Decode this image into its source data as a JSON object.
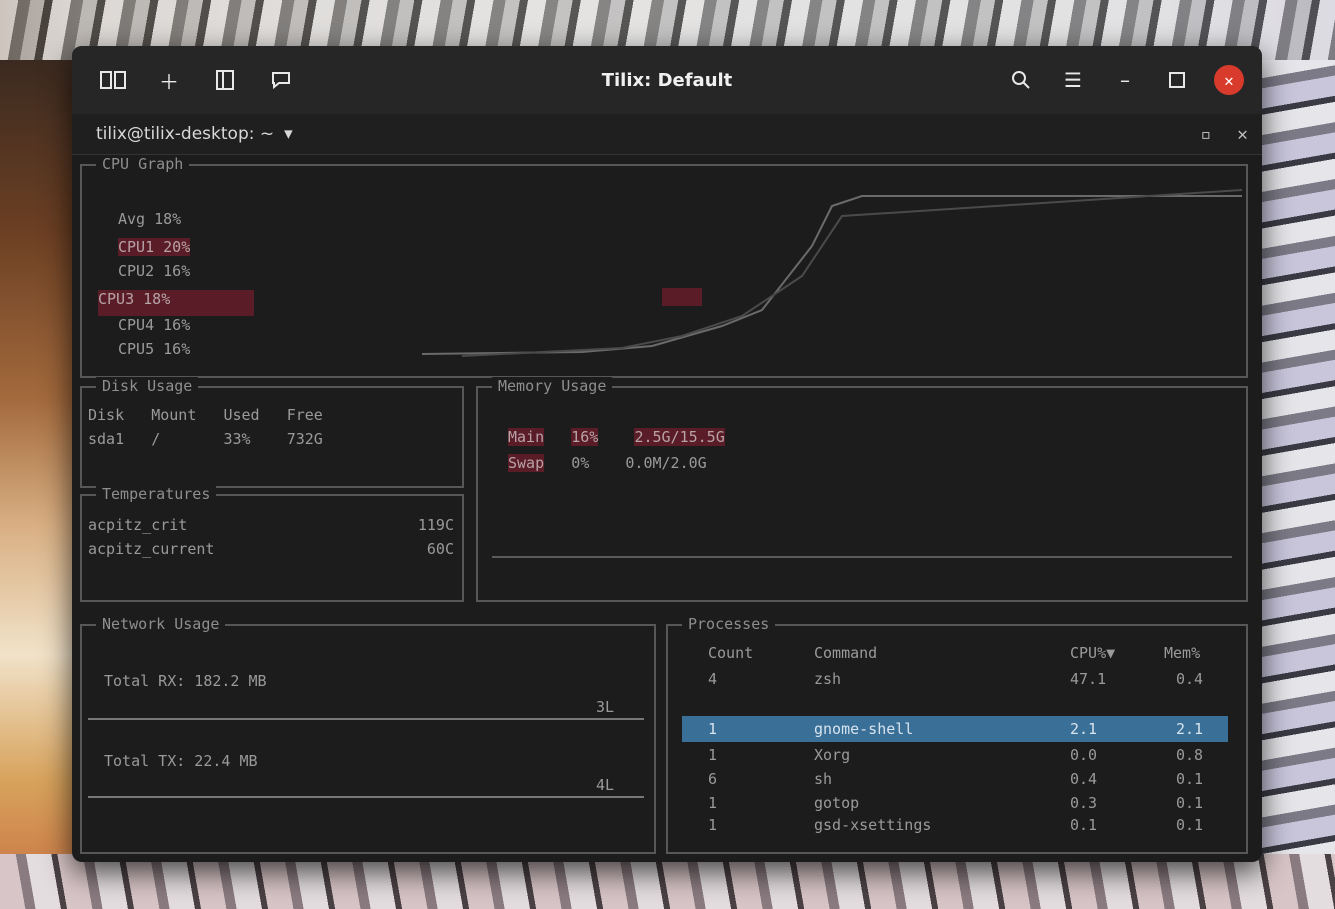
{
  "window": {
    "title": "Tilix: Default",
    "session_label": "tilix@tilix-desktop: ~",
    "session_caret": "▾"
  },
  "headerbar": {
    "left_icons": [
      "split-icon",
      "add-icon",
      "sidebar-icon",
      "chat-icon"
    ],
    "right_icons": [
      "search-icon",
      "menu-icon",
      "minimize-icon",
      "maximize-icon",
      "close-icon"
    ]
  },
  "cpu_graph": {
    "title": "CPU Graph",
    "legend": [
      {
        "label": "Avg",
        "value": "18%"
      },
      {
        "label": "CPU1",
        "value": "20%"
      },
      {
        "label": "CPU2",
        "value": "16%"
      },
      {
        "label": "CPU3",
        "value": "18%"
      },
      {
        "label": "CPU4",
        "value": "16%"
      },
      {
        "label": "CPU5",
        "value": "16%"
      }
    ]
  },
  "disk_usage": {
    "title": "Disk Usage",
    "headers": [
      "Disk",
      "Mount",
      "Used",
      "Free"
    ],
    "rows": [
      [
        "sda1",
        "/",
        "33%",
        "732G"
      ]
    ]
  },
  "memory_usage": {
    "title": "Memory Usage",
    "rows": [
      {
        "label": "Main",
        "percent": "16%",
        "detail": "2.5G/15.5G"
      },
      {
        "label": "Swap",
        "percent": "0%",
        "detail": "0.0M/2.0G"
      }
    ]
  },
  "temperatures": {
    "title": "Temperatures",
    "rows": [
      {
        "label": "acpitz_crit",
        "value": "119C"
      },
      {
        "label": "acpitz_current",
        "value": "60C"
      }
    ]
  },
  "network": {
    "title": "Network Usage",
    "rx_label": "Total RX: 182.2 MB",
    "tx_label": "Total TX: 22.4 MB",
    "rx_rate": "3L",
    "tx_rate": "4L"
  },
  "processes": {
    "title": "Processes",
    "headers": [
      "Count",
      "Command",
      "CPU%▼",
      "Mem%"
    ],
    "rows": [
      {
        "count": "4",
        "command": "zsh",
        "cpu": "47.1",
        "mem": "0.4"
      },
      {
        "count": "1",
        "command": "gnome-shell",
        "cpu": "2.1",
        "mem": "2.1"
      },
      {
        "count": "1",
        "command": "Xorg",
        "cpu": "0.0",
        "mem": "0.8"
      },
      {
        "count": "6",
        "command": "sh",
        "cpu": "0.4",
        "mem": "0.1"
      },
      {
        "count": "1",
        "command": "gotop",
        "cpu": "0.3",
        "mem": "0.1"
      },
      {
        "count": "1",
        "command": "gsd-xsettings",
        "cpu": "0.1",
        "mem": "0.1"
      }
    ]
  },
  "colors": {
    "accent_highlight": "#5a1d27",
    "selection": "#3a6f97",
    "close_button": "#d83a2c"
  }
}
